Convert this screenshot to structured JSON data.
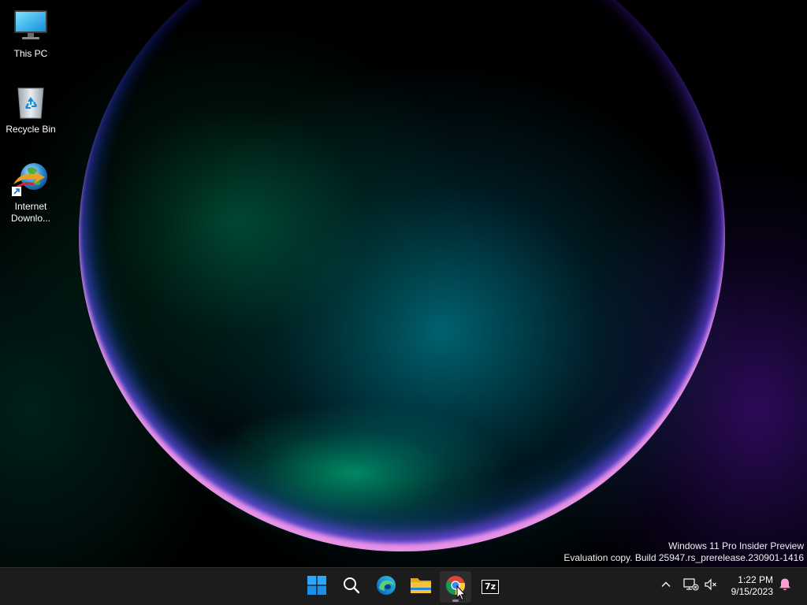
{
  "desktop": {
    "icons": [
      {
        "label": "This PC",
        "icon": "monitor-icon"
      },
      {
        "label": "Recycle Bin",
        "icon": "recycle-bin-icon"
      },
      {
        "label_line1": "Internet",
        "label_line2": "Downlo...",
        "icon": "internet-download-manager-icon"
      }
    ],
    "watermark": {
      "line1": "Windows 11 Pro Insider Preview",
      "line2": "Evaluation copy. Build 25947.rs_prerelease.230901-1416"
    }
  },
  "taskbar": {
    "apps": [
      {
        "name": "Start",
        "icon": "windows-start-icon"
      },
      {
        "name": "Search",
        "icon": "search-icon"
      },
      {
        "name": "Microsoft Edge",
        "icon": "edge-icon"
      },
      {
        "name": "File Explorer",
        "icon": "folder-icon"
      },
      {
        "name": "Google Chrome",
        "icon": "chrome-icon",
        "active": true
      },
      {
        "name": "7-Zip",
        "icon": "7zip-icon",
        "text": "7z"
      }
    ],
    "tray": {
      "overflow": "chevron-up-icon",
      "network": "network-disconnected-icon",
      "volume": "volume-muted-icon",
      "notifications": "bell-icon"
    },
    "clock": {
      "time": "1:22 PM",
      "date": "9/15/2023"
    }
  },
  "colors": {
    "taskbar_bg": "#1c1c1c",
    "start_blue": "#29a8ff",
    "folder_yellow": "#f5c33b",
    "bell_pink": "#ff9ed2"
  }
}
